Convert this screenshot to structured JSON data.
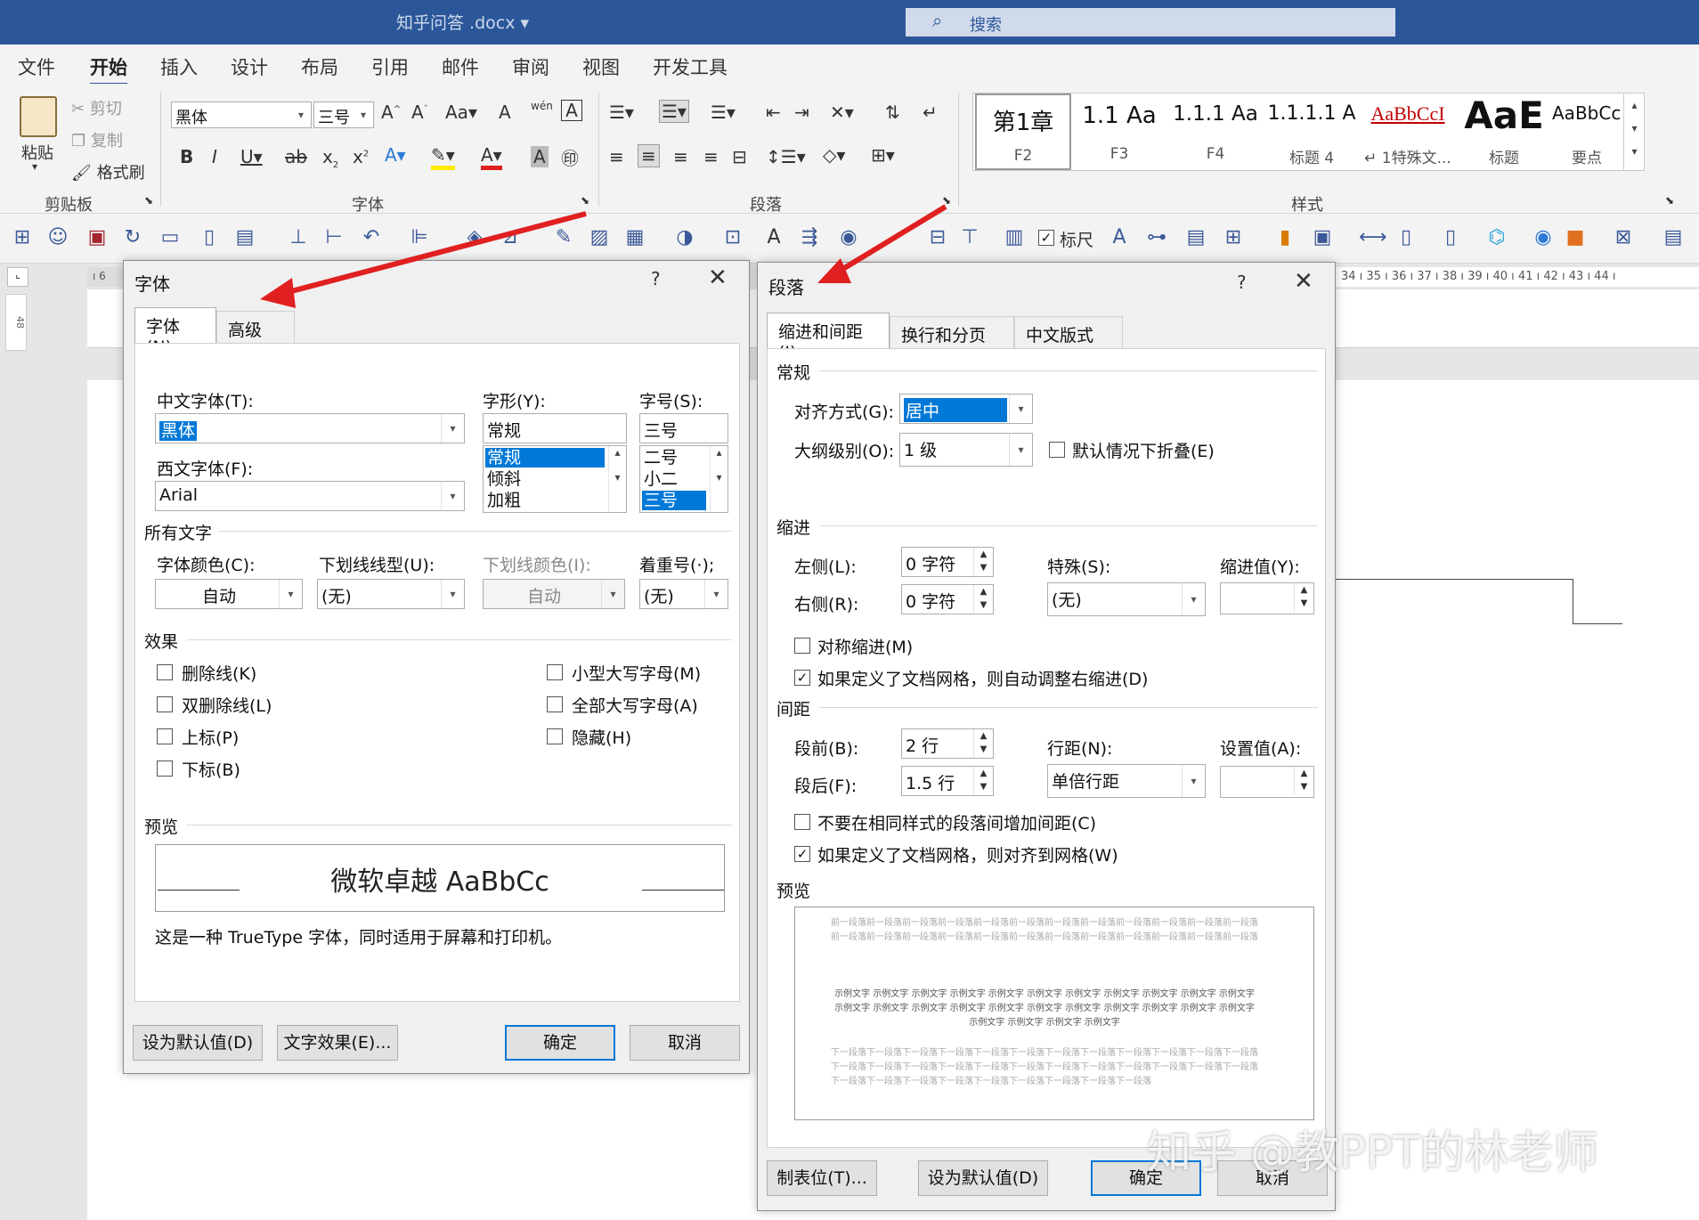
{
  "titlebar": {
    "doc_title": "知乎问答 .docx ▾",
    "search_placeholder": "搜索"
  },
  "ribbon_tabs": [
    "文件",
    "开始",
    "插入",
    "设计",
    "布局",
    "引用",
    "邮件",
    "审阅",
    "视图",
    "开发工具"
  ],
  "clipboard": {
    "paste": "粘贴",
    "cut": "剪切",
    "copy": "复制",
    "format_painter": "格式刷",
    "group_label": "剪贴板"
  },
  "font_group": {
    "font_name": "黑体",
    "font_size": "三号",
    "group_label": "字体"
  },
  "paragraph_group": {
    "group_label": "段落"
  },
  "styles_group": {
    "group_label": "样式",
    "items": [
      {
        "preview": "第1章",
        "name": "F2"
      },
      {
        "preview": "1.1 Aa",
        "name": "F3"
      },
      {
        "preview": "1.1.1 Aa",
        "name": "F4"
      },
      {
        "preview": "1.1.1.1 A",
        "name": "标题 4"
      },
      {
        "preview": "AaBbCcI",
        "name": "↵ 1特殊文..."
      },
      {
        "preview": "AaE",
        "name": "标题"
      },
      {
        "preview": "AaBbCcD",
        "name": "要点"
      }
    ]
  },
  "qat": {
    "ruler_check": "标尺"
  },
  "ruler": {
    "left_ticks": "6",
    "right_ticks": "34 ı 35 ı 36 ı 37 ı 38 ı 39 ı 40 ı 41 ı 42 ı 43 ı 44 ı",
    "vertical": "48"
  },
  "font_dialog": {
    "title": "字体",
    "help": "?",
    "tabs": [
      "字体(N)",
      "高级(V)"
    ],
    "chinese_font_label": "中文字体(T):",
    "chinese_font_value": "黑体",
    "western_font_label": "西文字体(F):",
    "western_font_value": "Arial",
    "style_label": "字形(Y):",
    "style_value": "常规",
    "style_options": [
      "常规",
      "倾斜",
      "加粗"
    ],
    "size_label": "字号(S):",
    "size_value": "三号",
    "size_options": [
      "二号",
      "小二",
      "三号"
    ],
    "all_text_section": "所有文字",
    "font_color_label": "字体颜色(C):",
    "font_color_value": "自动",
    "underline_style_label": "下划线线型(U):",
    "underline_style_value": "(无)",
    "underline_color_label": "下划线颜色(I):",
    "underline_color_value": "自动",
    "emphasis_label": "着重号(·);",
    "emphasis_value": "(无)",
    "effects_section": "效果",
    "effects": [
      {
        "label": "删除线(K)",
        "checked": false
      },
      {
        "label": "双删除线(L)",
        "checked": false
      },
      {
        "label": "上标(P)",
        "checked": false
      },
      {
        "label": "下标(B)",
        "checked": false
      },
      {
        "label": "小型大写字母(M)",
        "checked": false
      },
      {
        "label": "全部大写字母(A)",
        "checked": false
      },
      {
        "label": "隐藏(H)",
        "checked": false
      }
    ],
    "preview_section": "预览",
    "preview_text": "微软卓越  AaBbCc",
    "preview_note": "这是一种 TrueType 字体，同时适用于屏幕和打印机。",
    "btn_default": "设为默认值(D)",
    "btn_text_effects": "文字效果(E)...",
    "btn_ok": "确定",
    "btn_cancel": "取消"
  },
  "para_dialog": {
    "title": "段落",
    "help": "?",
    "tabs": [
      "缩进和间距(I)",
      "换行和分页(P)",
      "中文版式(H)"
    ],
    "general_section": "常规",
    "alignment_label": "对齐方式(G):",
    "alignment_value": "居中",
    "outline_label": "大纲级别(O):",
    "outline_value": "1 级",
    "collapse_label": "默认情况下折叠(E)",
    "indent_section": "缩进",
    "left_label": "左侧(L):",
    "left_value": "0 字符",
    "right_label": "右侧(R):",
    "right_value": "0 字符",
    "special_label": "特殊(S):",
    "special_value": "(无)",
    "indent_by_label": "缩进值(Y):",
    "mirror_label": "对称缩进(M)",
    "auto_right_label": "如果定义了文档网格，则自动调整右缩进(D)",
    "spacing_section": "间距",
    "before_label": "段前(B):",
    "before_value": "2 行",
    "after_label": "段后(F):",
    "after_value": "1.5 行",
    "line_spacing_label": "行距(N):",
    "line_spacing_value": "单倍行距",
    "at_label": "设置值(A):",
    "no_space_label": "不要在相同样式的段落间增加间距(C)",
    "snap_grid_label": "如果定义了文档网格，则对齐到网格(W)",
    "preview_section": "预览",
    "preview_prev": "前一段落前一段落前一段落前一段落前一段落前一段落前一段落前一段落前一段落前一段落前一段落前一段落前一段落前一段落前一段落前一段落前一段落前一段落前一段落前一段落前一段落前一段落前一段落前一段落",
    "preview_sample": "示例文字 示例文字 示例文字 示例文字 示例文字 示例文字 示例文字 示例文字 示例文字 示例文字 示例文字 示例文字 示例文字 示例文字 示例文字 示例文字 示例文字 示例文字 示例文字 示例文字 示例文字 示例文字 示例文字 示例文字 示例文字 示例文字",
    "preview_next": "下一段落下一段落下一段落下一段落下一段落下一段落下一段落下一段落下一段落下一段落下一段落下一段落下一段落下一段落下一段落下一段落下一段落下一段落下一段落下一段落下一段落下一段落下一段落下一段落下一段落下一段落下一段落下一段落下一段落下一段落下一段落下一段落下一段落",
    "btn_tabs": "制表位(T)...",
    "btn_default": "设为默认值(D)",
    "btn_ok": "确定",
    "btn_cancel": "取消"
  },
  "watermark": "知乎 @教PPT的林老师",
  "colors": {
    "word_blue": "#2b579a",
    "selection": "#0078d7",
    "arrow_red": "#e02020"
  }
}
